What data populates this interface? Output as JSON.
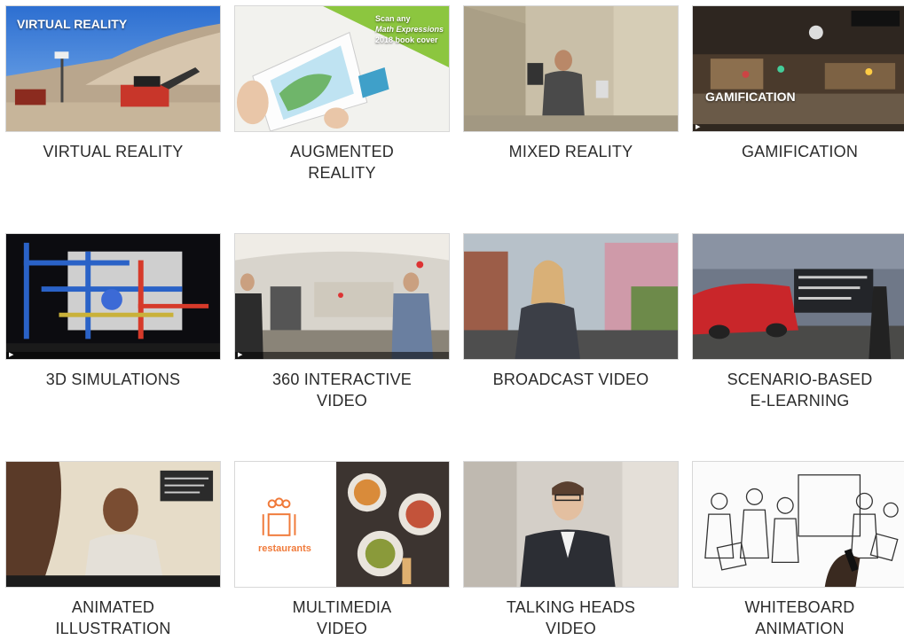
{
  "cards": [
    {
      "label": "VIRTUAL REALITY",
      "overlay": "VIRTUAL REALITY"
    },
    {
      "label": "AUGMENTED\nREALITY",
      "overlay_lines": [
        "Scan any",
        "Math Expressions",
        "2018 book cover"
      ]
    },
    {
      "label": "MIXED REALITY"
    },
    {
      "label": "GAMIFICATION",
      "overlay": "GAMIFICATION"
    },
    {
      "label": "3D SIMULATIONS"
    },
    {
      "label": "360 INTERACTIVE\nVIDEO"
    },
    {
      "label": "BROADCAST VIDEO"
    },
    {
      "label": "SCENARIO-BASED\nE-LEARNING"
    },
    {
      "label": "ANIMATED\nILLUSTRATION"
    },
    {
      "label": "MULTIMEDIA\nVIDEO",
      "overlay": "restaurants"
    },
    {
      "label": "TALKING HEADS\nVIDEO"
    },
    {
      "label": "WHITEBOARD\nANIMATION"
    }
  ],
  "colors": {
    "caption": "#2b2b2b",
    "restaurants_orange": "#f07a3a",
    "ar_green": "#8cc63f"
  }
}
